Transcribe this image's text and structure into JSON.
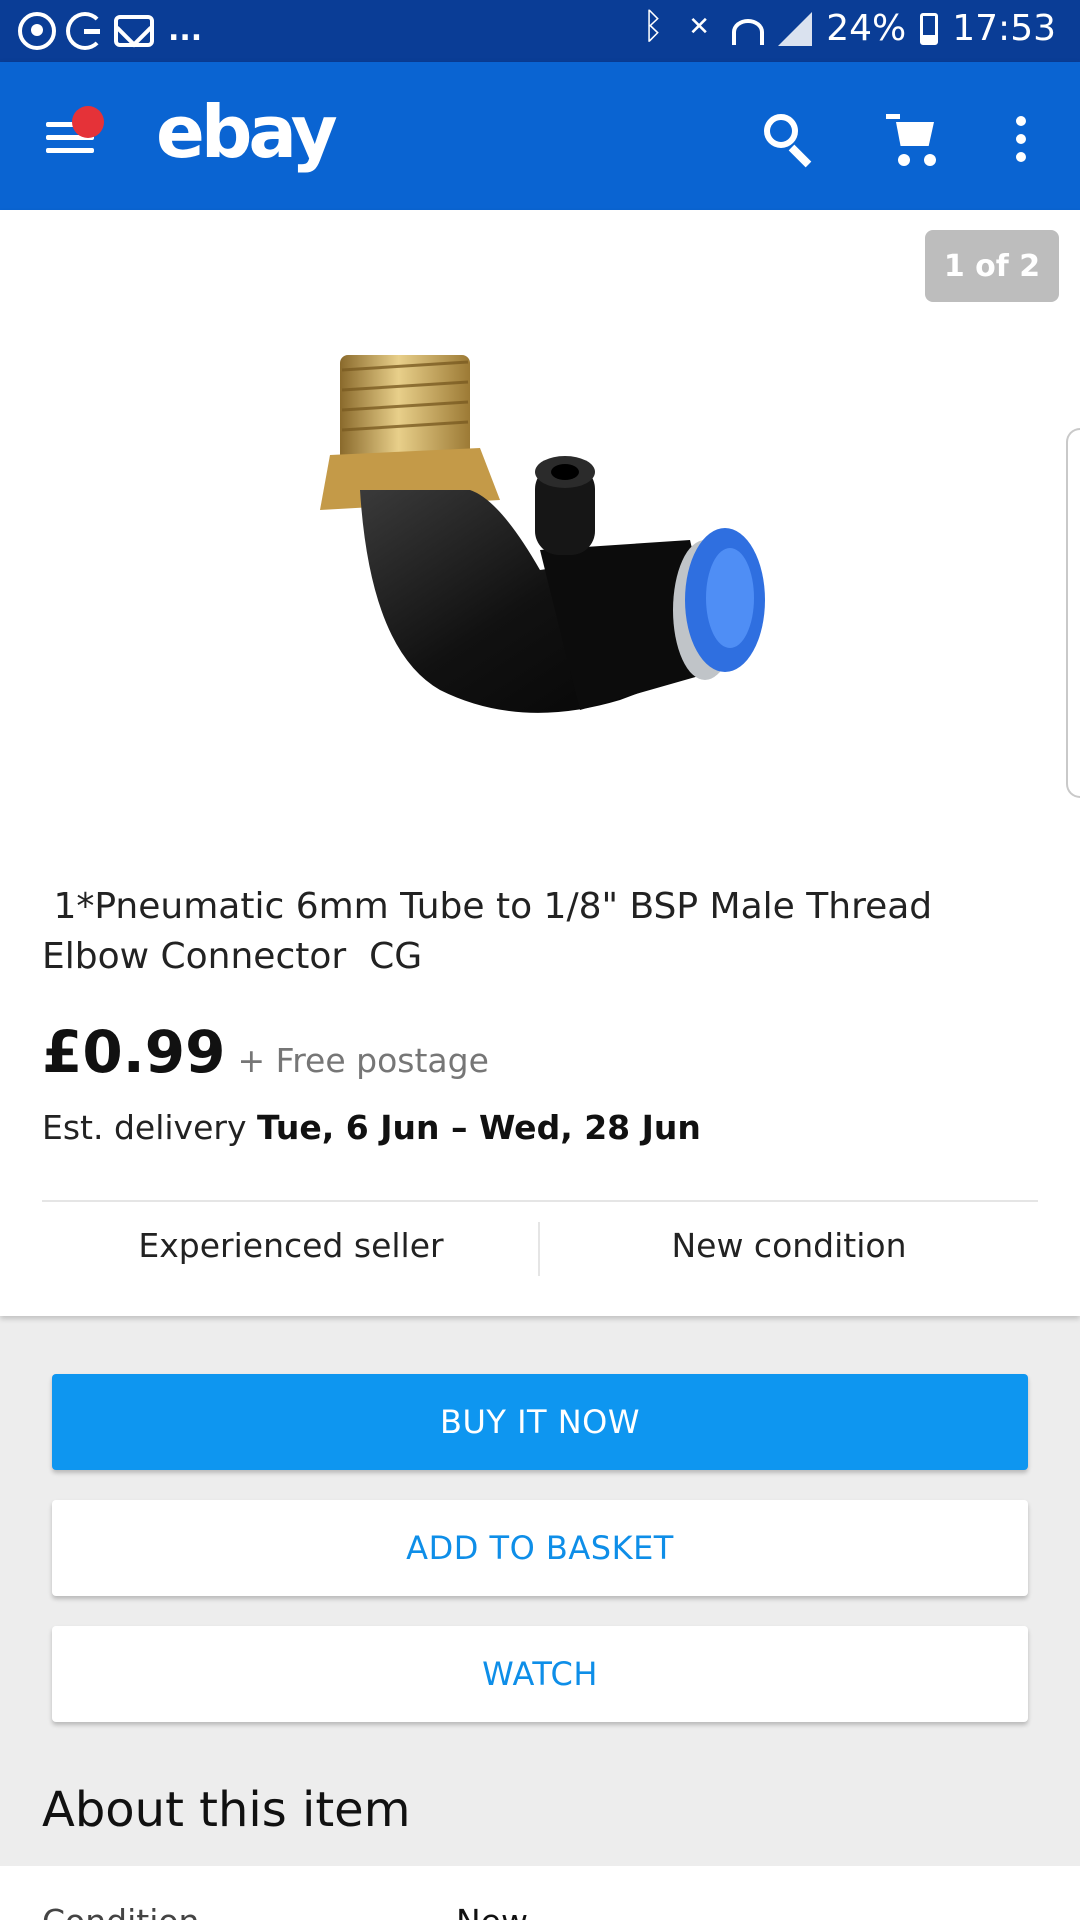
{
  "status_bar": {
    "notification_icons": [
      "whatsapp-icon",
      "g-icon",
      "mail-icon"
    ],
    "overflow": "...",
    "battery": "24%",
    "time": "17:53"
  },
  "app_bar": {
    "logo": "ebay",
    "notification_dot_color": "#e53238",
    "background_color": "#0a64d2"
  },
  "gallery": {
    "pager": "1 of 2",
    "image_alt": "Pneumatic elbow connector"
  },
  "listing": {
    "title": " 1*Pneumatic 6mm Tube to 1/8\" BSP Male Thread Elbow Connector  CG",
    "price": "£0.99",
    "postage": "+ Free postage",
    "delivery_label": "Est. delivery",
    "delivery_range": "Tue, 6 Jun – Wed, 28 Jun",
    "seller_badge": "Experienced seller",
    "condition_badge": "New condition"
  },
  "actions": {
    "buy_now": "BUY IT NOW",
    "add_to_basket": "ADD TO BASKET",
    "watch": "WATCH",
    "primary_color": "#0e96f0"
  },
  "about": {
    "heading": "About this item",
    "condition_label": "Condition",
    "condition_value": "New"
  }
}
